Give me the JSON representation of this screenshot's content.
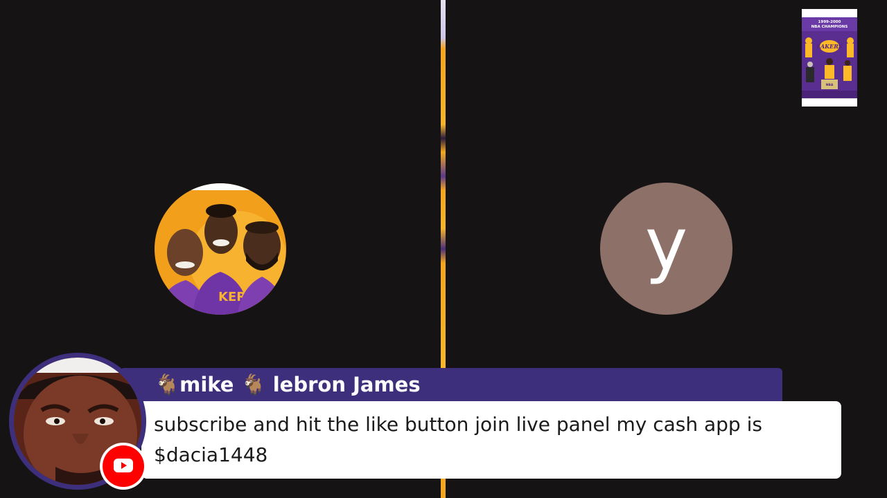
{
  "participants": {
    "left": {
      "avatar": "lakers-legends-photo"
    },
    "right": {
      "avatar_letter": "y",
      "avatar_color": "#8d7068"
    }
  },
  "shared_screen": {
    "poster_text": "1999-2000 NBA CHAMPIONS",
    "team": "LAKERS"
  },
  "banner": {
    "name": "🐐mike 🐐 lebron James",
    "message": "subscribe and hit the like button join live panel my cash app is $dacia1448",
    "badge_icon": "youtube-icon",
    "name_bar_color": "#3d2f7c"
  }
}
